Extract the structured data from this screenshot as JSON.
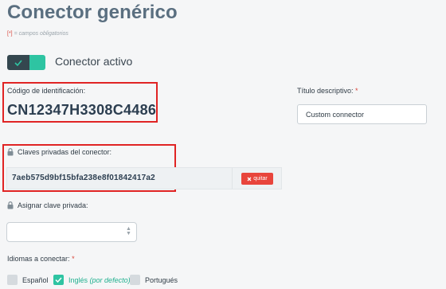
{
  "page": {
    "title": "Conector genérico",
    "required_mark": "[*]",
    "required_note": " = campos obligatorios"
  },
  "toggle": {
    "label": "Conector activo",
    "state": "on",
    "color_on": "#2ec4a2"
  },
  "identification": {
    "label": "Código de identificación:",
    "value": "CN12347H3308C4486"
  },
  "descriptive_title": {
    "label": "Título descriptivo:",
    "required": "*",
    "value": "Custom connector"
  },
  "private_keys": {
    "label": "Claves privadas del conector:",
    "icon": "lock-icon",
    "keys": [
      {
        "value": "7aeb575d9bf15bfa238e8f01842417a2",
        "remove_label": "quitar",
        "remove_icon": "close-icon"
      }
    ]
  },
  "assign_key": {
    "label": "Asignar clave privada:",
    "icon": "lock-icon",
    "selected": ""
  },
  "languages": {
    "label": "Idiomas a conectar:",
    "required": "*",
    "options": [
      {
        "label": "Español",
        "suffix": "",
        "checked": false
      },
      {
        "label": "Inglés",
        "suffix": "(por defecto)",
        "checked": true
      },
      {
        "label": "Portugués",
        "suffix": "",
        "checked": false
      }
    ]
  },
  "colors": {
    "accent": "#2ec4a2",
    "danger": "#e8453c",
    "highlight_border": "#e02424"
  }
}
